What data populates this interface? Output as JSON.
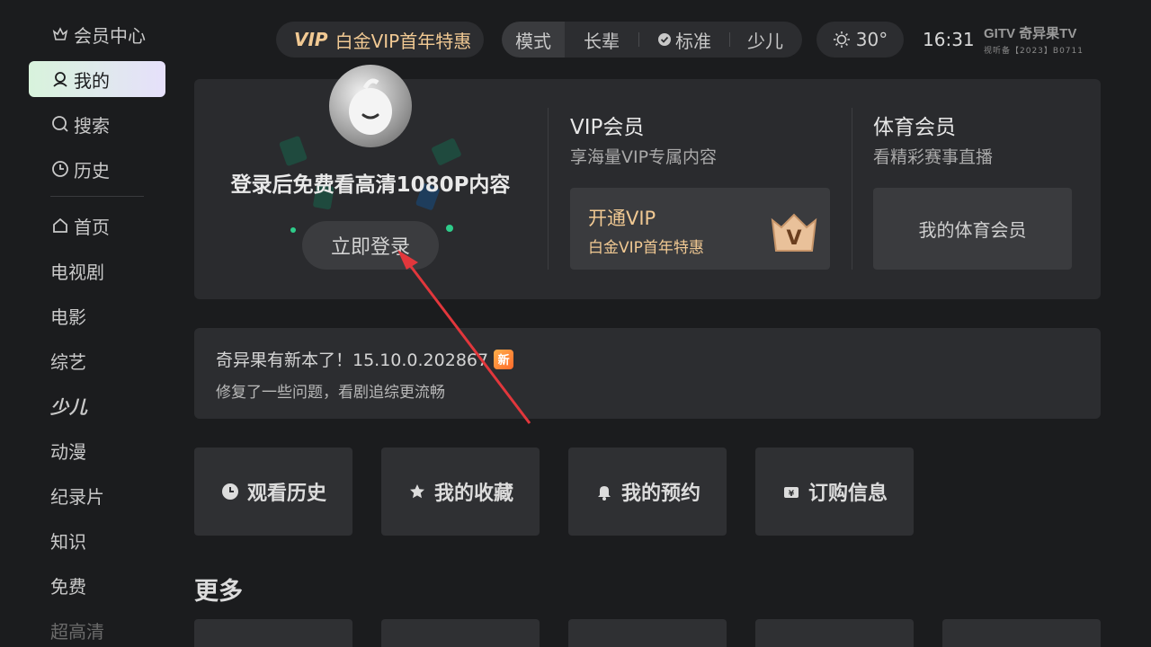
{
  "sidebar": {
    "items": [
      {
        "label": "会员中心",
        "icon": "crown-icon"
      },
      {
        "label": "我的",
        "icon": "user-icon",
        "active": true
      },
      {
        "label": "搜索",
        "icon": "search-icon"
      },
      {
        "label": "历史",
        "icon": "clock-icon"
      }
    ],
    "nav": [
      {
        "label": "首页",
        "icon": "home-icon"
      },
      {
        "label": "电视剧"
      },
      {
        "label": "电影"
      },
      {
        "label": "综艺"
      },
      {
        "label": "少儿"
      },
      {
        "label": "动漫"
      },
      {
        "label": "纪录片"
      },
      {
        "label": "知识"
      },
      {
        "label": "免费"
      },
      {
        "label": "超高清"
      }
    ]
  },
  "topbar": {
    "vip_tag": "VIP",
    "vip_promo": "白金VIP首年特惠",
    "modes": [
      "模式",
      "长辈",
      "标准",
      "少儿"
    ],
    "weather": "30°",
    "time": "16:31",
    "logo_text": "GITV 奇异果TV",
    "logo_sub": "视听备【2023】B0711"
  },
  "hero": {
    "login_prompt": "登录后免费看高清1080P内容",
    "login_button": "立即登录",
    "vip_title": "VIP会员",
    "vip_sub": "享海量VIP专属内容",
    "vip_card_title": "开通VIP",
    "vip_card_sub": "白金VIP首年特惠",
    "sport_title": "体育会员",
    "sport_sub": "看精彩赛事直播",
    "sport_button": "我的体育会员"
  },
  "update": {
    "line1": "奇异果有新本了！15.10.0.202867",
    "badge": "新",
    "line2": "修复了一些问题，看剧追综更流畅"
  },
  "tiles": [
    {
      "label": "观看历史",
      "icon": "clock-icon"
    },
    {
      "label": "我的收藏",
      "icon": "star-icon"
    },
    {
      "label": "我的预约",
      "icon": "bell-icon"
    },
    {
      "label": "订购信息",
      "icon": "ticket-icon"
    }
  ],
  "more_title": "更多",
  "colors": {
    "background": "#1b1c1e",
    "card": "#2a2b2e",
    "gold": "#f1c993",
    "active_gradient_start": "#d8f3dc",
    "active_gradient_end": "#e6e0fb",
    "annotation_arrow": "#e2373c"
  }
}
